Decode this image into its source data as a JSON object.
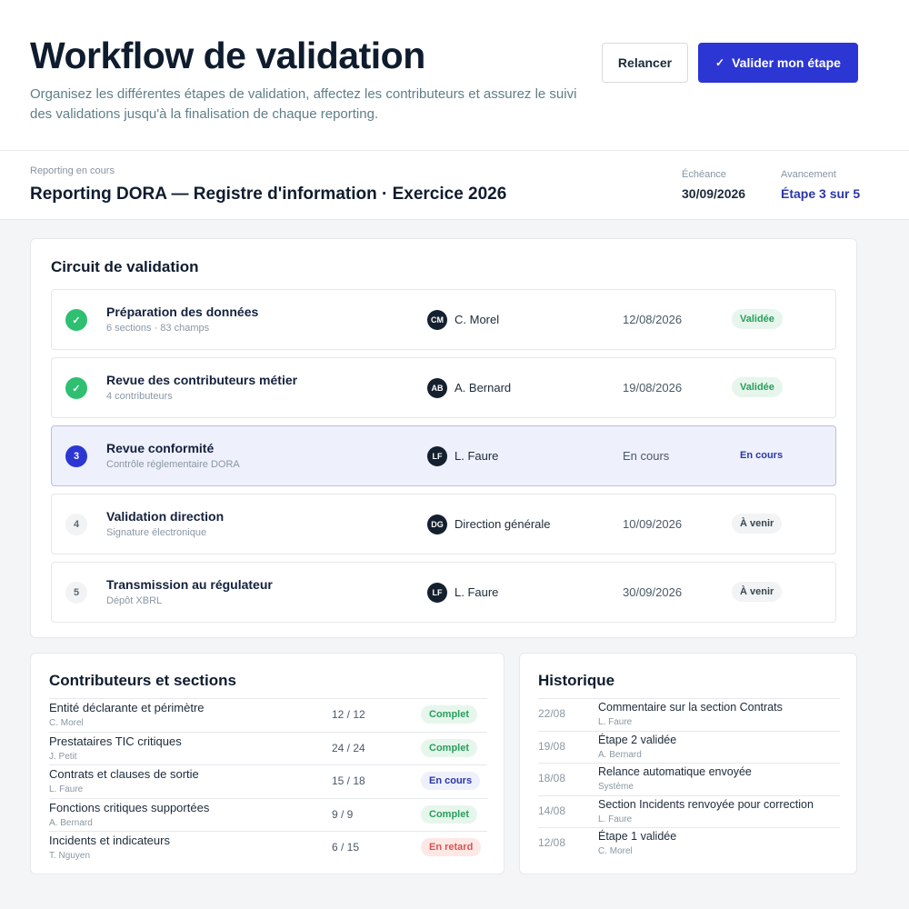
{
  "header": {
    "title": "Workflow de validation",
    "subtitle": "Organisez les différentes étapes de validation, affectez les contributeurs et assurez le suivi des validations jusqu'à la finalisation de chaque reporting.",
    "relaunch_label": "Relancer",
    "validate_label": "Valider mon étape",
    "validate_icon": "check-icon",
    "primary_color": "#2b36d3"
  },
  "report": {
    "eyebrow": "Reporting en cours",
    "title": "Reporting DORA — Registre d'information · Exercice 2026",
    "deadline_label": "Échéance",
    "deadline_value": "30/09/2026",
    "progress_label": "Avancement",
    "progress_value": "Étape 3 sur 5"
  },
  "circuit": {
    "title": "Circuit de validation",
    "steps": [
      {
        "icon": "✓",
        "state": "done",
        "name": "Préparation des données",
        "sub": "6 sections · 83 champs",
        "initials": "CM",
        "assignee": "C. Morel",
        "date": "12/08/2026",
        "status": "Validée",
        "tone": "green"
      },
      {
        "icon": "✓",
        "state": "done",
        "name": "Revue des contributeurs métier",
        "sub": "4 contributeurs",
        "initials": "AB",
        "assignee": "A. Bernard",
        "date": "19/08/2026",
        "status": "Validée",
        "tone": "green"
      },
      {
        "icon": "3",
        "state": "current",
        "name": "Revue conformité",
        "sub": "Contrôle réglementaire DORA",
        "initials": "LF",
        "assignee": "L. Faure",
        "date": "En cours",
        "status": "En cours",
        "tone": "blue"
      },
      {
        "icon": "4",
        "state": "todo",
        "name": "Validation direction",
        "sub": "Signature électronique",
        "initials": "DG",
        "assignee": "Direction générale",
        "date": "10/09/2026",
        "status": "À venir",
        "tone": "gray"
      },
      {
        "icon": "5",
        "state": "todo",
        "name": "Transmission au régulateur",
        "sub": "Dépôt XBRL",
        "initials": "LF",
        "assignee": "L. Faure",
        "date": "30/09/2026",
        "status": "À venir",
        "tone": "gray"
      }
    ]
  },
  "contributors": {
    "title": "Contributeurs et sections",
    "rows": [
      {
        "name": "Entité déclarante et périmètre",
        "person": "C. Morel",
        "count": "12 / 12",
        "status": "Complet",
        "tone": "green"
      },
      {
        "name": "Prestataires TIC critiques",
        "person": "J. Petit",
        "count": "24 / 24",
        "status": "Complet",
        "tone": "green"
      },
      {
        "name": "Contrats et clauses de sortie",
        "person": "L. Faure",
        "count": "15 / 18",
        "status": "En cours",
        "tone": "blue"
      },
      {
        "name": "Fonctions critiques supportées",
        "person": "A. Bernard",
        "count": "9 / 9",
        "status": "Complet",
        "tone": "green"
      },
      {
        "name": "Incidents et indicateurs",
        "person": "T. Nguyen",
        "count": "6 / 15",
        "status": "En retard",
        "tone": "red"
      }
    ]
  },
  "history": {
    "title": "Historique",
    "items": [
      {
        "date": "22/08",
        "text": "Commentaire sur la section Contrats",
        "person": "L. Faure"
      },
      {
        "date": "19/08",
        "text": "Étape 2 validée",
        "person": "A. Bernard"
      },
      {
        "date": "18/08",
        "text": "Relance automatique envoyée",
        "person": "Système"
      },
      {
        "date": "14/08",
        "text": "Section Incidents renvoyée pour correction",
        "person": "L. Faure"
      },
      {
        "date": "12/08",
        "text": "Étape 1 validée",
        "person": "C. Morel"
      }
    ]
  }
}
